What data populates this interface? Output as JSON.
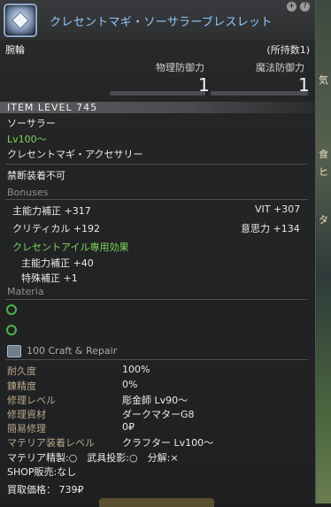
{
  "item": {
    "name": "クレセントマギ・ソーサラーブレスレット",
    "category": "腕輪",
    "owned": "(所持数1)"
  },
  "header_icons": [
    "+",
    "?"
  ],
  "stats": {
    "phys_label": "物理防御力",
    "phys_value": "1",
    "mag_label": "魔法防御力",
    "mag_value": "1"
  },
  "item_level": "ITEM LEVEL 745",
  "job": "ソーサラー",
  "level_req": "Lv100〜",
  "item_type": "クレセントマギ・アクセサリー",
  "restriction": "禁断装着不可",
  "bonuses": {
    "title": "Bonuses",
    "row1_left": "主能力補正 +317",
    "row1_right": "VIT +307",
    "row2_left": "クリティカル +192",
    "row2_right": "意思力 +134",
    "special_title": "クレセントアイル専用効果",
    "special1": "主能力補正 +40",
    "special2": "特殊補正 +1"
  },
  "materia": {
    "title": "Materia",
    "slots": 2
  },
  "craft": {
    "title": "100 Craft & Repair",
    "rows": [
      {
        "k": "耐久度",
        "v": "100%"
      },
      {
        "k": "錬精度",
        "v": "0%"
      },
      {
        "k": "修理レベル",
        "v": "彫金師 Lv90〜"
      },
      {
        "k": "修理資材",
        "v": "ダークマターG8"
      },
      {
        "k": "簡易修理",
        "v": "0₽"
      },
      {
        "k": "マテリア装着レベル",
        "v": "クラフター Lv100〜"
      }
    ],
    "flags": "マテリア精製:○　武具投影:○　分解:×",
    "shop": "SHOP販売:なし",
    "price": "買取価格： 739₽"
  },
  "background_fragments": [
    "気",
    "食",
    "ヒ",
    "タ"
  ],
  "colors": {
    "item_name": "#8fc8ff",
    "green_text": "#7fd45a",
    "materia_slot": "#4bb544",
    "craft_key": "#b8a78a"
  }
}
